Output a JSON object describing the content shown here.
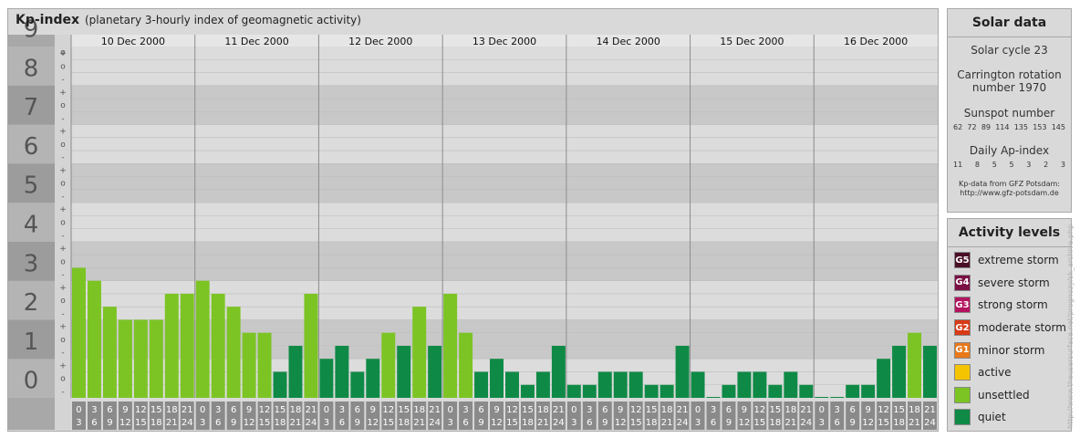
{
  "header": {
    "title": "Kp-index",
    "subtitle": "(planetary 3-hourly index of geomagnetic activity)"
  },
  "solar": {
    "title": "Solar data",
    "cycle": "Solar cycle 23",
    "carrington_line1": "Carrington rotation",
    "carrington_line2": "number 1970",
    "sunspot_title": "Sunspot number",
    "sunspot_values": [
      "62",
      "72",
      "89",
      "114",
      "135",
      "153",
      "145"
    ],
    "ap_title": "Daily Ap-index",
    "ap_values": [
      "11",
      "8",
      "5",
      "5",
      "3",
      "2",
      "3"
    ],
    "credit_line1": "Kp-data from GFZ Potsdam:",
    "credit_line2": "http://www.gfz-potsdam.de"
  },
  "activity": {
    "title": "Activity levels",
    "items": [
      {
        "badge": "G5",
        "label": "extreme storm",
        "color": "#4a0f26"
      },
      {
        "badge": "G4",
        "label": "severe storm",
        "color": "#7a1044"
      },
      {
        "badge": "G3",
        "label": "strong storm",
        "color": "#b4145f"
      },
      {
        "badge": "G2",
        "label": "moderate storm",
        "color": "#d83a16"
      },
      {
        "badge": "G1",
        "label": "minor storm",
        "color": "#e8781a"
      },
      {
        "badge": "",
        "label": "active",
        "color": "#f5c400"
      },
      {
        "badge": "",
        "label": "unsettled",
        "color": "#7cc424"
      },
      {
        "badge": "",
        "label": "quiet",
        "color": "#0f8a46"
      }
    ]
  },
  "watermark": "http://www.theusersurface.net/prognozy/sk_archive.php",
  "chart_data": {
    "type": "bar",
    "title": "Kp-index",
    "subtitle": "(planetary 3-hourly index of geomagnetic activity)",
    "ylim": [
      0,
      9
    ],
    "yticks": [
      "0",
      "1",
      "2",
      "3",
      "4",
      "5",
      "6",
      "7",
      "8",
      "9"
    ],
    "minor_ticks": [
      "-",
      "o",
      "+"
    ],
    "days": [
      "10 Dec 2000",
      "11 Dec 2000",
      "12 Dec 2000",
      "13 Dec 2000",
      "14 Dec 2000",
      "15 Dec 2000",
      "16 Dec 2000"
    ],
    "slot_top": [
      "0",
      "3",
      "6",
      "9",
      "12",
      "15",
      "18",
      "21"
    ],
    "slot_bottom": [
      "3",
      "6",
      "9",
      "12",
      "15",
      "18",
      "21",
      "24"
    ],
    "values": [
      3.333,
      3.0,
      2.333,
      2.0,
      2.0,
      2.0,
      2.667,
      2.667,
      3.0,
      2.667,
      2.333,
      1.667,
      1.667,
      0.667,
      1.333,
      2.667,
      1.0,
      1.333,
      0.667,
      1.0,
      1.667,
      1.333,
      2.333,
      1.333,
      2.667,
      1.667,
      0.667,
      1.0,
      0.667,
      0.333,
      0.667,
      1.333,
      0.333,
      0.333,
      0.667,
      0.667,
      0.667,
      0.333,
      0.333,
      1.333,
      0.667,
      0.0,
      0.333,
      0.667,
      0.667,
      0.333,
      0.667,
      0.333,
      0.0,
      0.0,
      0.333,
      0.333,
      1.0,
      1.333,
      1.667,
      1.333
    ],
    "colors": {
      "quiet": "#0f8a46",
      "unsettled": "#7cc424",
      "band_dark": "#c8c8c8",
      "band_light": "#dcdcdc",
      "label_column": "#a8a8a8",
      "slot_label_bg": "#8a8a8a",
      "day_divider": "#8c8c8c"
    }
  }
}
